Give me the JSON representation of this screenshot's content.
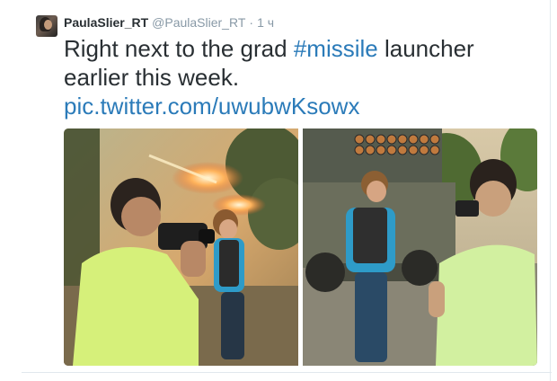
{
  "tweet": {
    "author_name": "PaulaSlier_RT",
    "author_handle": "@PaulaSlier_RT",
    "separator": "·",
    "timestamp": "1 ч",
    "text_part1": "Right next to the grad ",
    "hashtag": "#missile",
    "text_part2": " launcher",
    "text_line2": "earlier this week.",
    "media_link": "pic.twitter.com/uwubwKsowx"
  },
  "colors": {
    "text": "#292f33",
    "muted": "#8899a6",
    "link": "#2b7bb9",
    "border": "#e1e8ed"
  },
  "icons": {
    "avatar": "profile-photo"
  }
}
